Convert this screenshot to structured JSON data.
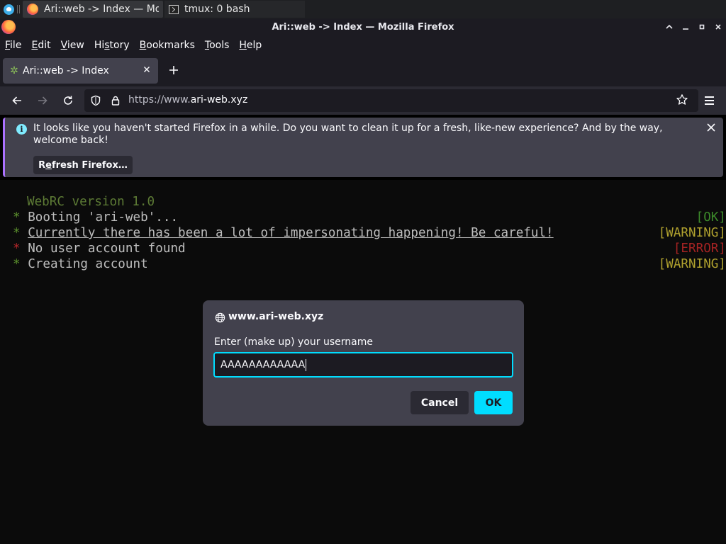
{
  "taskbar": {
    "tasks": [
      {
        "label": "Ari::web -> Index — Mo..."
      },
      {
        "label": "tmux: 0 bash"
      }
    ]
  },
  "window": {
    "title": "Ari::web -> Index — Mozilla Firefox"
  },
  "menubar": {
    "items": [
      {
        "access": "F",
        "rest": "ile"
      },
      {
        "access": "E",
        "rest": "dit"
      },
      {
        "access": "V",
        "rest": "iew"
      },
      {
        "pre": "Hi",
        "access": "s",
        "rest": "tory"
      },
      {
        "access": "B",
        "rest": "ookmarks"
      },
      {
        "access": "T",
        "rest": "ools"
      },
      {
        "access": "H",
        "rest": "elp"
      }
    ]
  },
  "tab": {
    "label": "Ari::web -> Index"
  },
  "urlbar": {
    "prefix": "https://www.",
    "domain": "ari-web.xyz"
  },
  "notification": {
    "message": "It looks like you haven't started Firefox in a while. Do you want to clean it up for a fresh, like-new experience? And by the way, welcome back!",
    "button_pre": "R",
    "button_access": "e",
    "button_rest": "fresh Firefox…"
  },
  "terminal": {
    "header": "WebRC version 1.0",
    "lines": [
      {
        "bullet": "*",
        "text": "Booting 'ari-web'...",
        "status": "[OK]",
        "kind": "ok",
        "underline": false
      },
      {
        "bullet": "*",
        "text": "Currently there has been a lot of impersonating happening! Be careful!",
        "status": "[WARNING]",
        "kind": "warn",
        "underline": true
      },
      {
        "bullet": "*",
        "text": "No user account found",
        "status": "[ERROR]",
        "kind": "error",
        "underline": false
      },
      {
        "bullet": "*",
        "text": "Creating account",
        "status": "[WARNING]",
        "kind": "warn",
        "underline": false
      }
    ]
  },
  "dialog": {
    "origin": "www.ari-web.xyz",
    "prompt": "Enter (make up) your username",
    "input_value": "AAAAAAAAAAAA",
    "cancel_label": "Cancel",
    "ok_label": "OK"
  },
  "colors": {
    "accent": "#00ddff",
    "ok": "#3c8a2a",
    "warning": "#b0a12e",
    "error": "#a62323"
  }
}
